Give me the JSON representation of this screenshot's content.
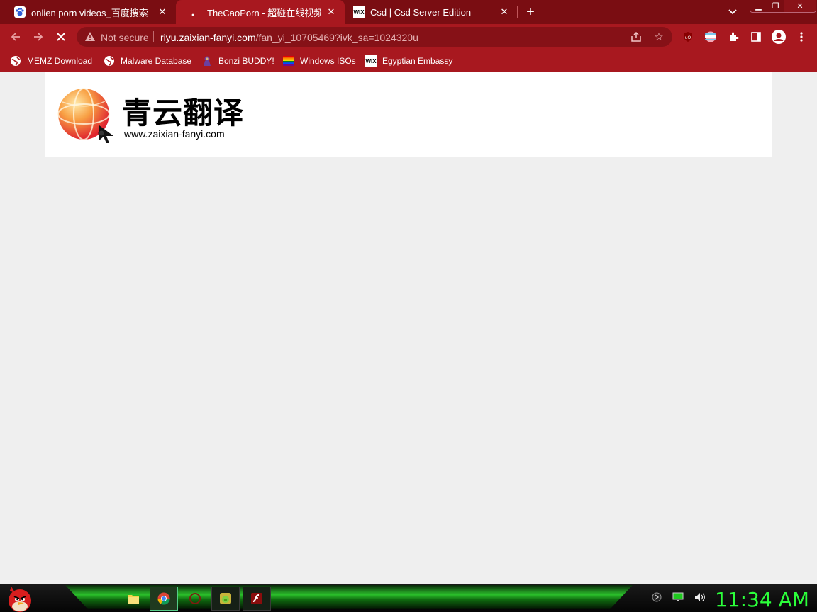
{
  "tabs": [
    {
      "title": "onlien porn videos_百度搜索",
      "favicon": "baidu-paw-icon",
      "active": false
    },
    {
      "title": "TheCaoPorn - 超碰在线视频 Team",
      "favicon": "loading-icon",
      "active": true
    },
    {
      "title": "Csd | Csd Server Edition",
      "favicon": "wix-icon",
      "active": false
    }
  ],
  "toolbar": {
    "security_label": "Not secure",
    "url_host": "riyu.zaixian-fanyi.com",
    "url_path": "/fan_yi_10705469?ivk_sa=1024320u"
  },
  "bookmarks": [
    {
      "label": "MEMZ Download",
      "icon": "globe-icon"
    },
    {
      "label": "Malware Database",
      "icon": "globe-icon"
    },
    {
      "label": "Bonzi BUDDY!",
      "icon": "bonzi-icon"
    },
    {
      "label": "Windows ISOs",
      "icon": "rainbow-flag-icon"
    },
    {
      "label": "Egyptian Embassy",
      "icon": "wix-icon"
    }
  ],
  "page": {
    "logo_title": "青云翻译",
    "logo_url": "www.zaixian-fanyi.com"
  },
  "taskbar": {
    "clock": "11:34 AM"
  },
  "colors": {
    "tabstrip": "#7a0d12",
    "toolbar": "#a8181f",
    "omnibox": "#861117",
    "clock": "#2bff3a"
  }
}
